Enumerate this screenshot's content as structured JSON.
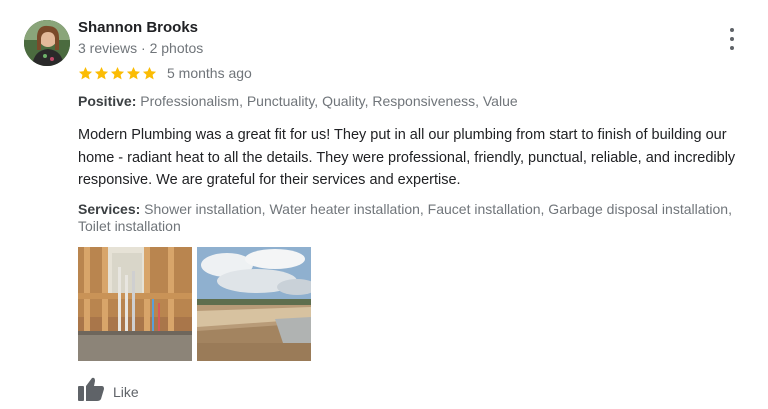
{
  "reviewer": {
    "name": "Shannon Brooks",
    "meta": "3 reviews · 2 photos"
  },
  "rating": {
    "stars": 5,
    "max_stars": 5,
    "time_ago": "5 months ago",
    "star_color": "#fbbc04"
  },
  "positive": {
    "label": "Positive:",
    "value": "Professionalism, Punctuality, Quality, Responsiveness, Value"
  },
  "review_text": "Modern Plumbing was a great fit for us! They put in all our plumbing from start to finish of building our home - radiant heat to all the details. They were professional, friendly, punctual, reliable, and incredibly responsive. We are grateful for their services and expertise.",
  "services": {
    "label": "Services:",
    "value": "Shower installation, Water heater installation, Faucet installation, Garbage disposal installation, Toilet installation"
  },
  "photos": [
    {
      "name": "photo-interior-framing"
    },
    {
      "name": "photo-site-landscape"
    }
  ],
  "actions": {
    "like_label": "Like",
    "more_icon": "more-vert-icon",
    "like_icon": "thumb-up-icon"
  }
}
